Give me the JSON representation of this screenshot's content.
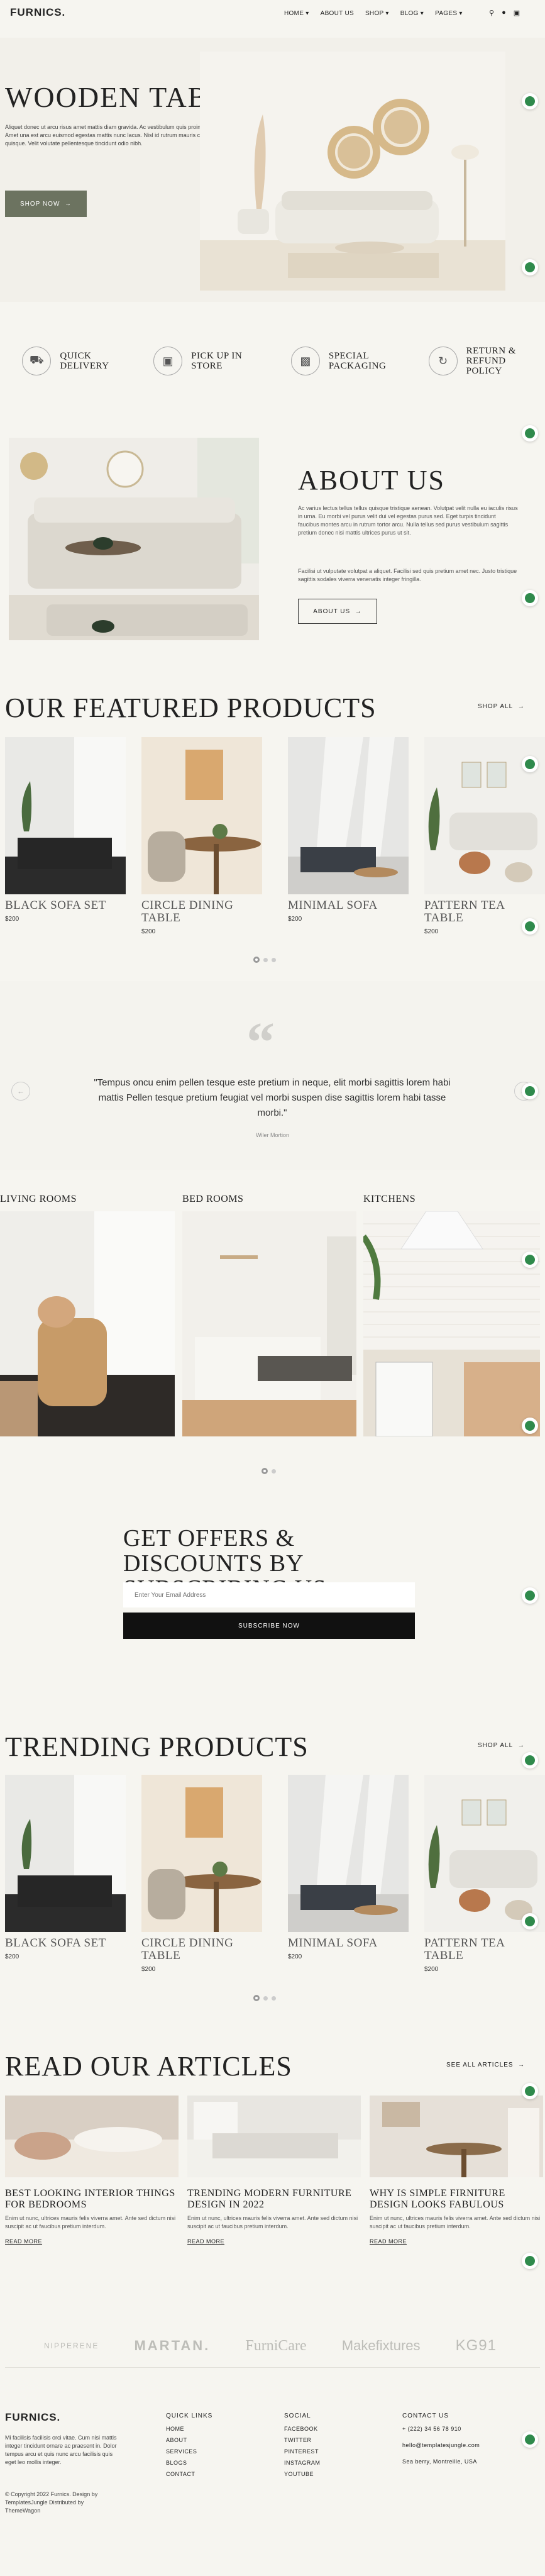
{
  "colors": {
    "bg": "#f6f5f0",
    "accent": "#6c7360",
    "dark": "#111111",
    "green": "#2f8a4c"
  },
  "header": {
    "logo": "FURNICS.",
    "nav": [
      "HOME ▾",
      "ABOUT US",
      "SHOP ▾",
      "BLOG ▾",
      "PAGES ▾"
    ],
    "icons": [
      "search-icon",
      "user-icon",
      "cart-icon"
    ]
  },
  "hero": {
    "title": "WOODEN TABLE SET",
    "text": "Aliquet donec ut arcu risus amet mattis diam gravida. Ac vestibulum quis proin in aliquam at et auctor. Amet una est arcu euismod egestas mattis nunc lacus. Nisl id rutrum mauris commodo habitant amet quisque. Velit volutate pellentesque tincidunt odio nibh.",
    "button": "SHOP NOW"
  },
  "features": [
    {
      "icon": "truck-icon",
      "label": "QUICK DELIVERY"
    },
    {
      "icon": "cart-icon",
      "label": "PICK UP IN STORE"
    },
    {
      "icon": "gift-icon",
      "label": "SPECIAL PACKAGING"
    },
    {
      "icon": "refresh-icon",
      "label": "RETURN & REFUND POLICY"
    }
  ],
  "about": {
    "title": "ABOUT US",
    "p1": "Ac varius lectus tellus tellus quisque tristique aenean. Volutpat velit nulla eu iaculis risus in urna. Eu morbi vel purus velit dui vel egestas purus sed. Eget turpis tincidunt faucibus montes arcu in rutrum tortor arcu. Nulla tellus sed purus vestibulum sagittis pretium donec nisi mattis ultrices purus ut sit.",
    "p2": "Facilisi ut vulputate volutpat a aliquet. Facilisi sed quis pretium amet nec. Justo tristique sagittis sodales viverra venenatis integer fringilla.",
    "button": "ABOUT US"
  },
  "featured": {
    "title": "OUR FEATURED PRODUCTS",
    "link": "SHOP ALL",
    "products": [
      {
        "name": "BLACK SOFA SET",
        "price": "$200"
      },
      {
        "name": "CIRCLE DINING TABLE",
        "price": "$200"
      },
      {
        "name": "MINIMAL SOFA",
        "price": "$200"
      },
      {
        "name": "PATTERN TEA TABLE",
        "price": "$200"
      }
    ]
  },
  "testimonial": {
    "quote": "\"Tempus oncu enim pellen tesque este pretium in neque, elit morbi sagittis lorem habi mattis Pellen tesque pretium feugiat vel morbi suspen dise sagittis lorem habi tasse morbi.\"",
    "author": "Wiler Mortion"
  },
  "rooms": [
    "LIVING ROOMS",
    "BED ROOMS",
    "KITCHENS"
  ],
  "subscribe": {
    "title": "GET OFFERS & DISCOUNTS BY SUBSCRIBING US",
    "placeholder": "Enter Your Email Address",
    "button": "SUBSCRIBE NOW"
  },
  "trending": {
    "title": "TRENDING PRODUCTS",
    "link": "SHOP ALL",
    "products": [
      {
        "name": "BLACK SOFA SET",
        "price": "$200"
      },
      {
        "name": "CIRCLE DINING TABLE",
        "price": "$200"
      },
      {
        "name": "MINIMAL SOFA",
        "price": "$200"
      },
      {
        "name": "PATTERN TEA TABLE",
        "price": "$200"
      }
    ]
  },
  "articles": {
    "title": "READ OUR ARTICLES",
    "link": "SEE ALL ARTICLES",
    "items": [
      {
        "title": "BEST LOOKING INTERIOR THINGS FOR BEDROOMS",
        "excerpt": "Enim ut nunc, ultrices mauris felis viverra amet. Ante sed dictum nisi suscipit ac ut faucibus pretium interdum.",
        "more": "READ MORE"
      },
      {
        "title": "TRENDING MODERN FURNITURE DESIGN IN 2022",
        "excerpt": "Enim ut nunc, ultrices mauris felis viverra amet. Ante sed dictum nisi suscipit ac ut faucibus pretium interdum.",
        "more": "READ MORE"
      },
      {
        "title": "WHY IS SIMPLE FIRNITURE DESIGN LOOKS FABULOUS",
        "excerpt": "Enim ut nunc, ultrices mauris felis viverra amet. Ante sed dictum nisi suscipit ac ut faucibus pretium interdum.",
        "more": "READ MORE"
      }
    ]
  },
  "brands": [
    "NIPPERENE",
    "MARTAN.",
    "FurniCare",
    "Makefixtures",
    "KG91"
  ],
  "footer": {
    "logo": "FURNICS.",
    "about": "Mi facilisis facilisis orci vitae. Cum nisi mattis integer tincidunt ornare ac praesent in. Dolor tempus arcu et quis nunc arcu facilisis quis eget leo mollis integer.",
    "copyright": "© Copyright 2022 Furnics. Design by TemplatesJungle Distributed by ThemeWagon",
    "quick_title": "QUICK LINKS",
    "quick": [
      "HOME",
      "ABOUT",
      "SERVICES",
      "BLOGS",
      "CONTACT"
    ],
    "social_title": "SOCIAL",
    "social": [
      "FACEBOOK",
      "TWITTER",
      "PINTEREST",
      "INSTAGRAM",
      "YOUTUBE"
    ],
    "contact_title": "CONTACT US",
    "phone": "+ (222) 34 56 78 910",
    "email": "hello@templatesjungle.com",
    "address": "Sea berry, Montreille, USA"
  }
}
